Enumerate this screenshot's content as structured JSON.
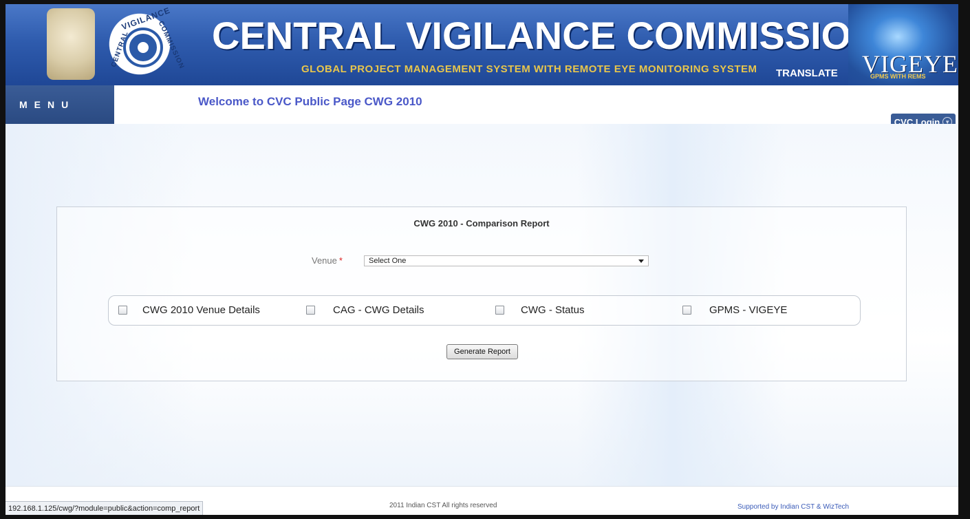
{
  "header": {
    "title": "CENTRAL VIGILANCE COMMISSION",
    "subtitle": "GLOBAL PROJECT MANAGEMENT SYSTEM WITH REMOTE EYE MONITORING SYSTEM",
    "translate_label": "TRANSLATE",
    "seal_text_top": "VIGILANCE",
    "seal_text_left": "CENTRAL",
    "seal_text_right": "COMMISSION",
    "logo_text": "VIGEYE",
    "logo_subtext": "GPMS WITH REMS",
    "emblem_icon": "national-emblem-icon"
  },
  "nav": {
    "menu_label": "MENU",
    "welcome": "Welcome to CVC Public Page CWG 2010",
    "login_label": "CVC Login"
  },
  "report": {
    "title": "CWG 2010 - Comparison Report",
    "venue_label": "Venue",
    "required_mark": "*",
    "venue_selected": "Select One",
    "options": [
      {
        "label": "CWG 2010 Venue Details",
        "checked": false
      },
      {
        "label": "CAG - CWG Details",
        "checked": false
      },
      {
        "label": "CWG - Status",
        "checked": false
      },
      {
        "label": "GPMS - VIGEYE",
        "checked": false
      }
    ],
    "generate_label": "Generate Report"
  },
  "footer": {
    "copyright": "2011 Indian CST All rights reserved",
    "supported": "Supported by Indian CST & WizTech"
  },
  "status_bar": {
    "url": "192.168.1.125/cwg/?module=public&action=comp_report"
  },
  "colors": {
    "banner": "#2f5cae",
    "title_gold": "#e8c64c",
    "welcome": "#4a58c8",
    "menu_bg": "#2a4a82"
  }
}
